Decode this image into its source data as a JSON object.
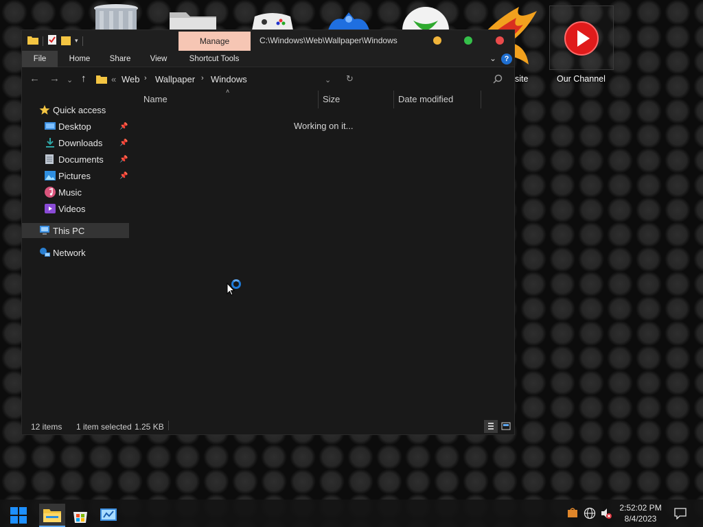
{
  "desktop": {
    "icons": [
      {
        "name": "recycle-bin",
        "label": ""
      },
      {
        "name": "folder",
        "label": ""
      },
      {
        "name": "xbox-controller",
        "label": ""
      },
      {
        "name": "network-app",
        "label": ""
      },
      {
        "name": "xbox-logo",
        "label": ""
      },
      {
        "name": "website-app",
        "label": "site"
      },
      {
        "name": "our-channel",
        "label": "Our Channel"
      }
    ]
  },
  "window": {
    "title_path": "C:\\Windows\\Web\\Wallpaper\\Windows",
    "context_tab": "Manage",
    "ribbon_tabs": [
      "File",
      "Home",
      "Share",
      "View",
      "Shortcut Tools"
    ],
    "help": "?",
    "breadcrumb": {
      "overflow": "«",
      "items": [
        "Web",
        "Wallpaper",
        "Windows"
      ]
    },
    "columns": [
      "Name",
      "Size",
      "Date modified"
    ],
    "status_message": "Working on it...",
    "nav": {
      "quick_access": "Quick access",
      "items": [
        {
          "label": "Desktop",
          "pinned": true
        },
        {
          "label": "Downloads",
          "pinned": true
        },
        {
          "label": "Documents",
          "pinned": true
        },
        {
          "label": "Pictures",
          "pinned": true
        },
        {
          "label": "Music",
          "pinned": false
        },
        {
          "label": "Videos",
          "pinned": false
        }
      ],
      "this_pc": "This PC",
      "network": "Network"
    },
    "status": {
      "items_count": "12 items",
      "selection": "1 item selected",
      "size": "1.25 KB"
    }
  },
  "traffic_lights": {
    "minimize": "#f0b43a",
    "maximize": "#35c04a",
    "close": "#ea4b4b"
  },
  "taskbar": {
    "apps": [
      {
        "name": "start-button",
        "active": false
      },
      {
        "name": "file-explorer",
        "active": true
      },
      {
        "name": "microsoft-store",
        "active": false
      },
      {
        "name": "control-panel",
        "active": false
      }
    ],
    "clock": {
      "time": "2:52:02 PM",
      "date": "8/4/2023"
    }
  }
}
